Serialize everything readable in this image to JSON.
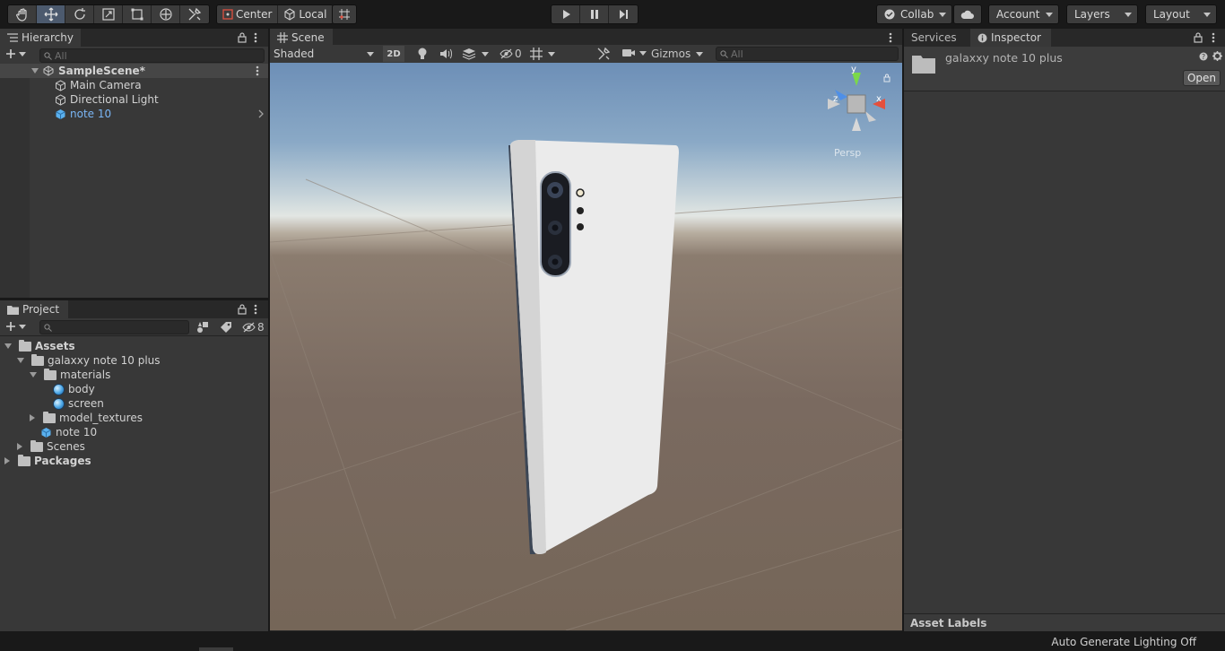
{
  "toolbar": {
    "pivot_label": "Center",
    "space_label": "Local",
    "collab_label": "Collab",
    "account_label": "Account",
    "layers_label": "Layers",
    "layout_label": "Layout"
  },
  "hierarchy": {
    "tab_label": "Hierarchy",
    "search_placeholder": "All",
    "scene_name": "SampleScene*",
    "items": [
      {
        "label": "Main Camera",
        "icon": "gameobject-icon"
      },
      {
        "label": "Directional Light",
        "icon": "gameobject-icon"
      },
      {
        "label": "note 10",
        "icon": "prefab-icon"
      }
    ]
  },
  "project": {
    "tab_label": "Project",
    "hidden_count": "8",
    "tree": {
      "assets": "Assets",
      "galaxy_folder": "galaxxy note 10 plus",
      "materials": "materials",
      "body": "body",
      "screen": "screen",
      "model_textures": "model_textures",
      "note10": "note 10",
      "scenes": "Scenes",
      "packages": "Packages"
    }
  },
  "scene": {
    "tab_label": "Scene",
    "shading_mode": "Shaded",
    "mode_2d": "2D",
    "hidden_count": "0",
    "gizmos_label": "Gizmos",
    "search_placeholder": "All",
    "projection_label": "Persp",
    "axis_labels": {
      "y": "y",
      "x": "x",
      "z": "z"
    }
  },
  "inspector": {
    "services_tab": "Services",
    "tab_label": "Inspector",
    "asset_name": "galaxxy note 10 plus",
    "open_button": "Open",
    "asset_labels": "Asset Labels"
  },
  "status": {
    "lighting": "Auto Generate Lighting Off"
  },
  "colors": {
    "accent_blue": "#7ab6f5",
    "panel_bg": "#383838",
    "app_bg": "#191919"
  }
}
